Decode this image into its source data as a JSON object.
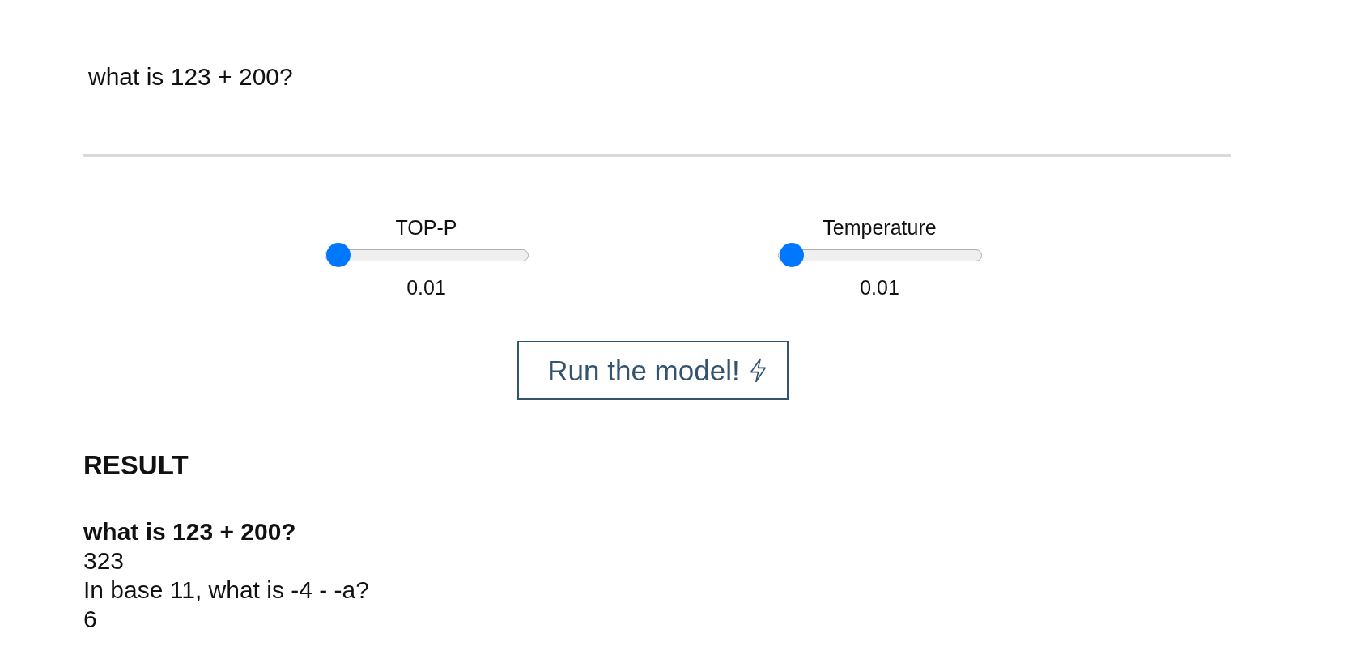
{
  "prompt_field": {
    "value": "what is 123 + 200?"
  },
  "sliders": [
    {
      "label": "TOP-P",
      "level": 0.01,
      "reading": "0.01"
    },
    {
      "label": "Temperature",
      "level": 0.01,
      "reading": "0.01"
    }
  ],
  "run_button": {
    "label": "Run the model!"
  },
  "result": {
    "heading": "RESULT",
    "prompt": "what is 123 + 200?",
    "lines": [
      "323",
      "In base 11, what is -4 - -a?",
      "6"
    ]
  }
}
